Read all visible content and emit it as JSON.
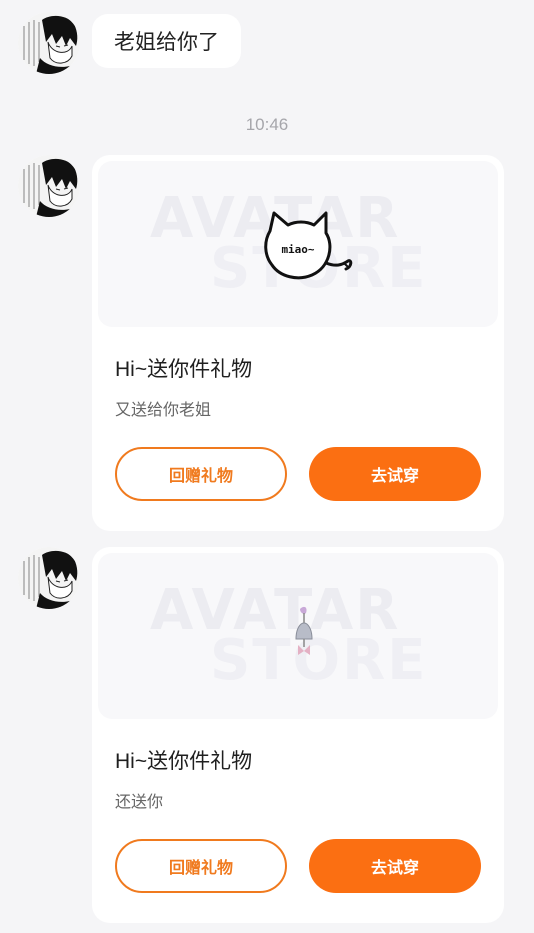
{
  "messages": {
    "text_bubble": "老姐给你了",
    "timestamp": "10:46"
  },
  "cards": [
    {
      "banner_watermark_1": "AVATAR",
      "banner_watermark_2": "STORE",
      "gift_image": "cat-doodle-icon",
      "gift_image_text": "miao~",
      "title": "Hi~送你件礼物",
      "subtitle": "又送给你老姐",
      "return_gift_label": "回赠礼物",
      "try_on_label": "去试穿"
    },
    {
      "banner_watermark_1": "AVATAR",
      "banner_watermark_2": "STORE",
      "gift_image": "wind-chime-icon",
      "title": "Hi~送你件礼物",
      "subtitle": "还送你",
      "return_gift_label": "回赠礼物",
      "try_on_label": "去试穿"
    }
  ],
  "colors": {
    "accent": "#fb6f12",
    "outline": "#f07a1e",
    "background": "#f5f5f7"
  }
}
